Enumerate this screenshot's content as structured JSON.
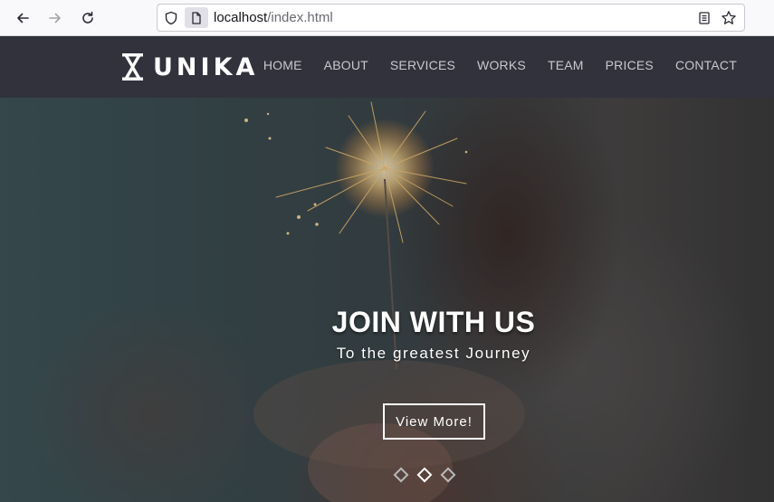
{
  "browser": {
    "url_host": "localhost",
    "url_path": "/index.html"
  },
  "site": {
    "logo_text": "UNIKA",
    "nav": [
      "HOME",
      "ABOUT",
      "SERVICES",
      "WORKS",
      "TEAM",
      "PRICES",
      "CONTACT"
    ]
  },
  "hero": {
    "title": "JOIN WITH US",
    "subtitle": "To the greatest Journey",
    "button_label": "View More!",
    "slides_total": 3,
    "active_slide": 2
  },
  "colors": {
    "header_bg": "#31323c",
    "nav_text": "#c8c9ce",
    "accent": "#ffffff"
  }
}
